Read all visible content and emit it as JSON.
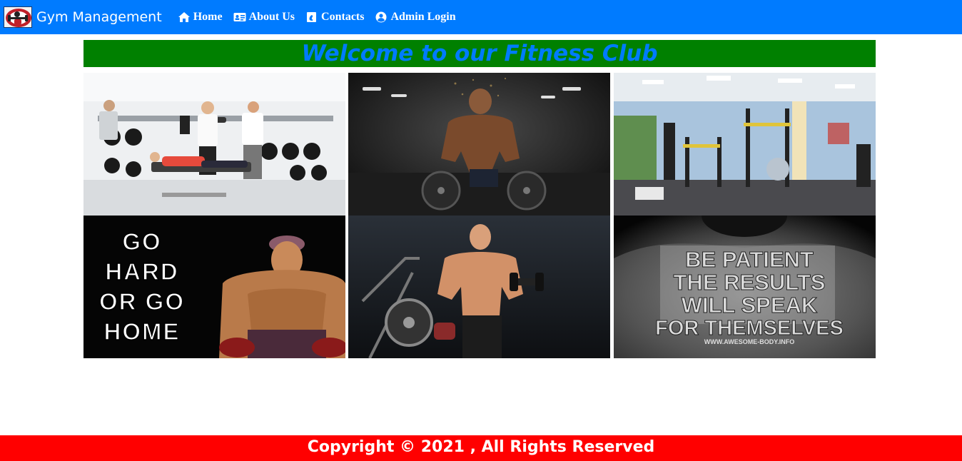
{
  "brand": {
    "name": "Gym Management",
    "logo_icon": "dumbbell-logo-icon"
  },
  "nav": {
    "items": [
      {
        "label": "Home",
        "icon": "home-icon"
      },
      {
        "label": "About Us",
        "icon": "id-card-icon"
      },
      {
        "label": "Contacts",
        "icon": "contact-book-icon"
      },
      {
        "label": "Admin Login",
        "icon": "user-circle-icon"
      }
    ]
  },
  "welcome": {
    "title": "Welcome to our Fitness Club"
  },
  "gallery": {
    "posters": {
      "go_hard": [
        "GO",
        "HARD",
        "OR GO",
        "HOME"
      ],
      "be_patient": [
        "BE PATIENT",
        "THE RESULTS",
        "WILL SPEAK",
        "FOR THEMSELVES"
      ],
      "be_patient_site": "WWW.AWESOME-BODY.INFO"
    }
  },
  "footer": {
    "copyright": "Copyright © 2021 , All Rights Reserved"
  },
  "colors": {
    "navbar": "#007bff",
    "welcome_bg": "#008000",
    "welcome_text": "#007bff",
    "footer_bg": "#ff0000",
    "text_light": "#ffffff"
  }
}
